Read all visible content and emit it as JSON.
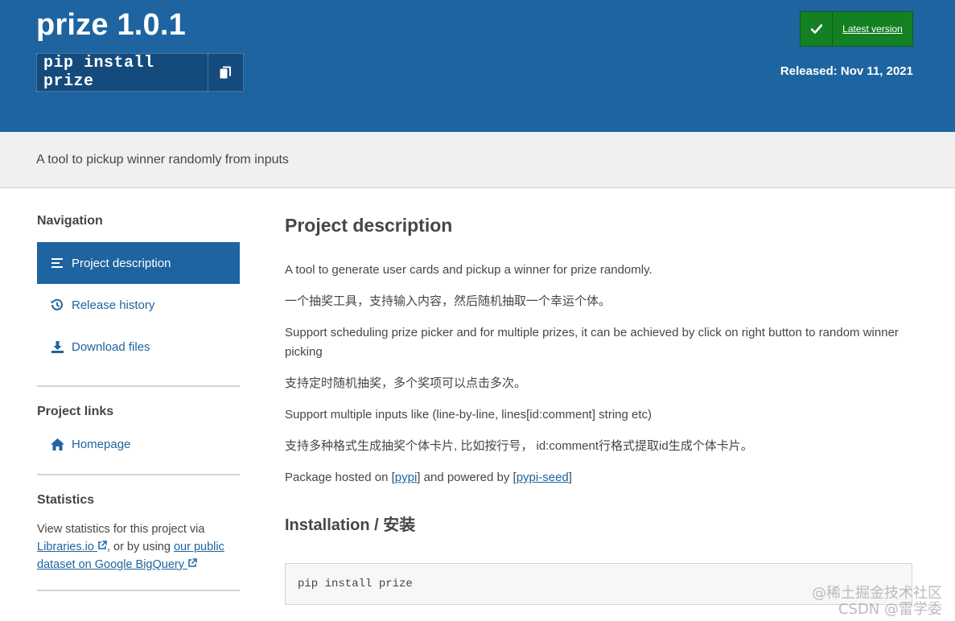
{
  "header": {
    "package_title": "prize 1.0.1",
    "pip_command": "pip install prize",
    "latest_version_label": "Latest version",
    "released": "Released: Nov 11, 2021"
  },
  "summary": "A tool to pickup winner randomly from inputs",
  "sidebar": {
    "navigation_heading": "Navigation",
    "nav_items": [
      {
        "label": "Project description",
        "icon": "list-icon",
        "active": true
      },
      {
        "label": "Release history",
        "icon": "history-icon",
        "active": false
      },
      {
        "label": "Download files",
        "icon": "download-icon",
        "active": false
      }
    ],
    "project_links_heading": "Project links",
    "homepage_label": "Homepage",
    "statistics_heading": "Statistics",
    "statistics": {
      "text_before": "View statistics for this project via ",
      "libraries_link": "Libraries.io",
      "text_middle": ", or by using ",
      "bigquery_link": "our public dataset on Google BigQuery"
    }
  },
  "main": {
    "description_heading": "Project description",
    "paragraphs": [
      "A tool to generate user cards and pickup a winner for prize randomly.",
      "一个抽奖工具，支持输入内容，然后随机抽取一个幸运个体。",
      "Support scheduling prize picker and for multiple prizes, it can be achieved by click on right button to random winner picking",
      "支持定时随机抽奖，多个奖项可以点击多次。",
      "Support multiple inputs like (line-by-line, lines[id:comment] string etc)",
      "支持多种格式生成抽奖个体卡片, 比如按行号， id:comment行格式提取id生成个体卡片。"
    ],
    "hosted": {
      "prefix": "Package hosted on [",
      "pypi_link": "pypi",
      "middle": "] and powered by [",
      "seed_link": "pypi-seed",
      "suffix": "]"
    },
    "installation_heading": "Installation / 安装",
    "install_code": "pip install prize"
  },
  "watermark": {
    "line1": "@稀土掘金技术社区",
    "line2": "CSDN @雷学委"
  },
  "colors": {
    "brand_blue": "#1e64a0",
    "latest_green": "#148024",
    "summary_bg": "#f0f0f0",
    "text": "#464646"
  }
}
